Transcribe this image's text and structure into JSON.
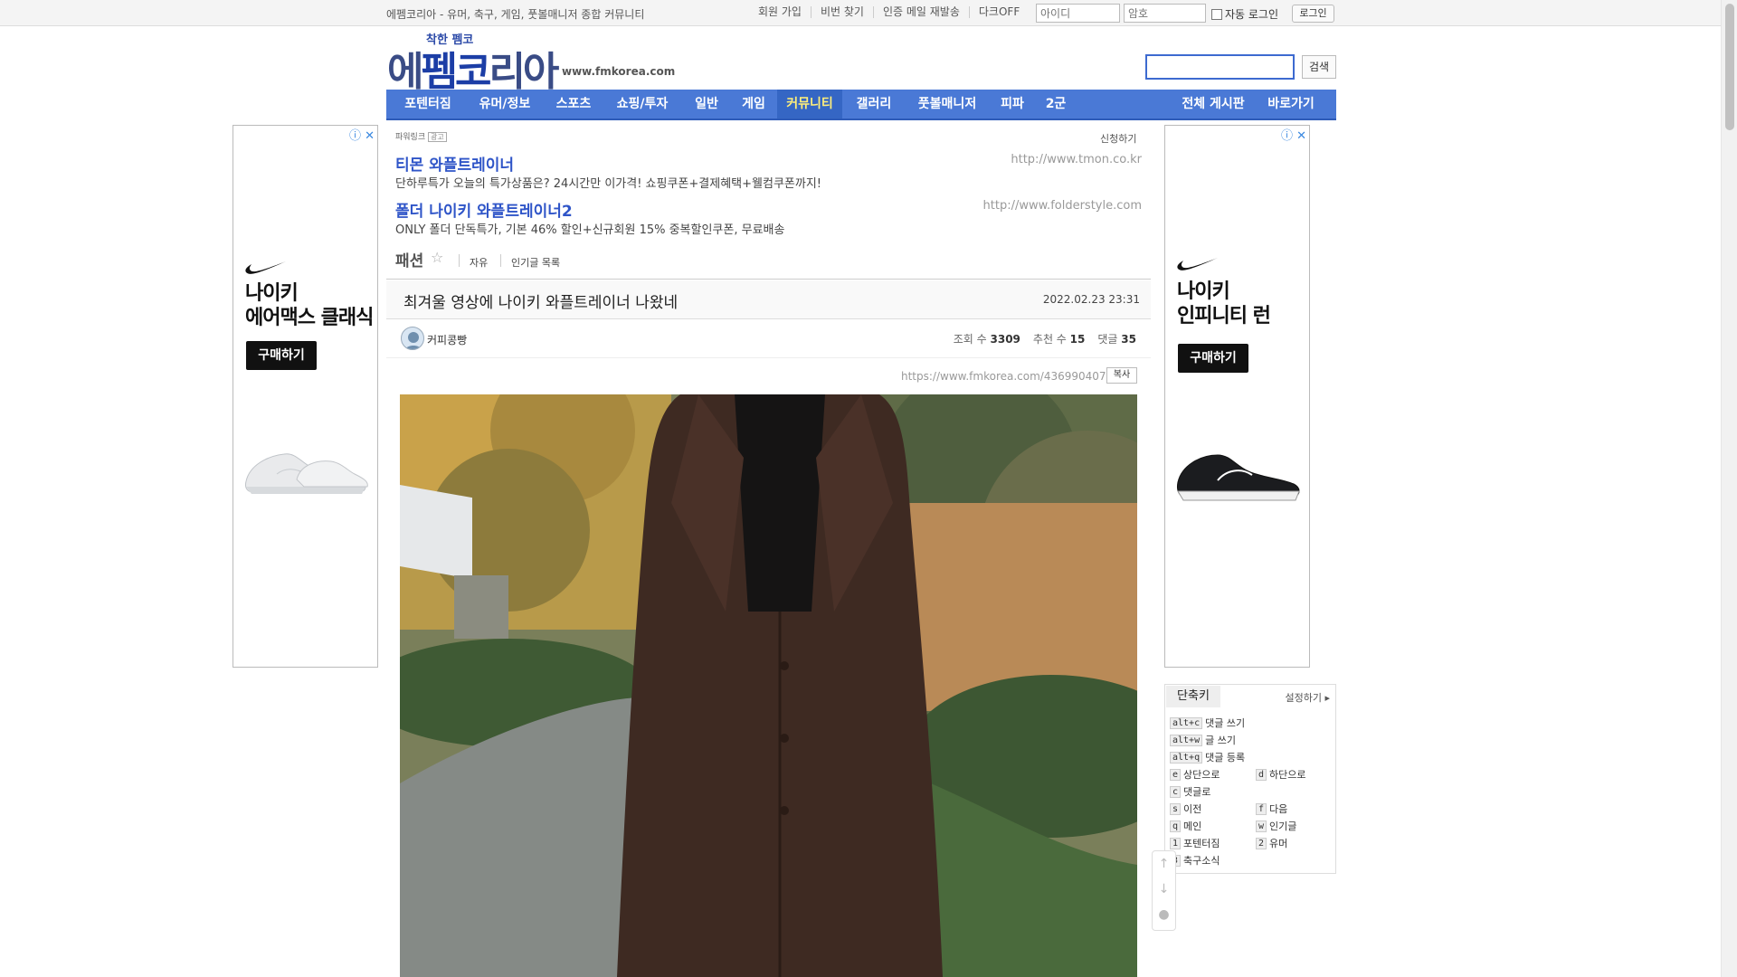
{
  "topbar": {
    "site_desc": "에펨코리아 - 유머, 축구, 게임, 풋볼매니저 종합 커뮤니티",
    "links": [
      "회원 가입",
      "비번 찾기",
      "인증 메일 재발송",
      "다크OFF"
    ],
    "id_placeholder": "아이디",
    "pw_placeholder": "암호",
    "autologin_label": "자동 로그인",
    "login_label": "로그인"
  },
  "header": {
    "logo_sub": "착한 펨코",
    "logo_part1": "에",
    "logo_part2": "펨코",
    "logo_part3": "리아",
    "url": "www.fmkorea.com",
    "search_label": "검색"
  },
  "nav": {
    "items": [
      "포텐터짐",
      "유머/정보",
      "스포츠",
      "쇼핑/투자",
      "일반",
      "게임",
      "커뮤니티",
      "갤러리",
      "풋볼매니저",
      "피파",
      "2군"
    ],
    "active": "커뮤니티",
    "right_items": [
      "전체 게시판",
      "바로가기"
    ]
  },
  "ads": {
    "left": {
      "title_line1": "나이키",
      "title_line2": "에어맥스 클래식",
      "buy": "구매하기"
    },
    "right": {
      "title_line1": "나이키",
      "title_line2": "인피니티 런",
      "buy": "구매하기"
    }
  },
  "powerlink": {
    "label": "파워링크",
    "badge": "광고",
    "apply": "신청하기",
    "items": [
      {
        "title": "티몬 와플트레이너",
        "desc": "단하루특가 오늘의 특가상품은? 24시간만 이가격! 쇼핑쿠폰+결제혜택+웰컴쿠폰까지!",
        "url": "http://www.tmon.co.kr"
      },
      {
        "title": "폴더 나이키 와플트레이너2",
        "desc": "ONLY 폴더 단독특가, 기본 46% 할인+신규회원 15% 중복할인쿠폰, 무료배송",
        "url": "http://www.folderstyle.com"
      }
    ]
  },
  "board": {
    "name": "패션",
    "tabs": [
      "자유",
      "인기글 목록"
    ]
  },
  "article": {
    "title": "최겨울 영상에 나이키 와플트레이너 나왔네",
    "date": "2022.02.23 23:31",
    "author": "커피콩빵",
    "views_label": "조회 수",
    "views": "3309",
    "likes_label": "추천 수",
    "likes": "15",
    "comments_label": "댓글",
    "comments": "35",
    "url": "https://www.fmkorea.com/4369904071",
    "copy_label": "복사"
  },
  "shortcuts": {
    "title": "단축키",
    "settings": "설정하기",
    "items": [
      {
        "key": "alt+c",
        "label": "댓글 쓰기"
      },
      {
        "key": "alt+w",
        "label": "글 쓰기"
      },
      {
        "key": "alt+q",
        "label": "댓글 등록"
      },
      {
        "key": "e",
        "label": "상단으로"
      },
      {
        "key": "d",
        "label": "하단으로"
      },
      {
        "key": "c",
        "label": "댓글로"
      },
      {
        "key": "s",
        "label": "이전"
      },
      {
        "key": "f",
        "label": "다음"
      },
      {
        "key": "q",
        "label": "메인"
      },
      {
        "key": "w",
        "label": "인기글"
      },
      {
        "key": "1",
        "label": "포텐터짐"
      },
      {
        "key": "2",
        "label": "유머"
      },
      {
        "key": "3",
        "label": "축구소식"
      }
    ]
  },
  "colors": {
    "nav_bg": "#4a79d6",
    "nav_active_text": "#ffef7a",
    "link_blue": "#2f55c8",
    "logo": "#3a4c86"
  }
}
